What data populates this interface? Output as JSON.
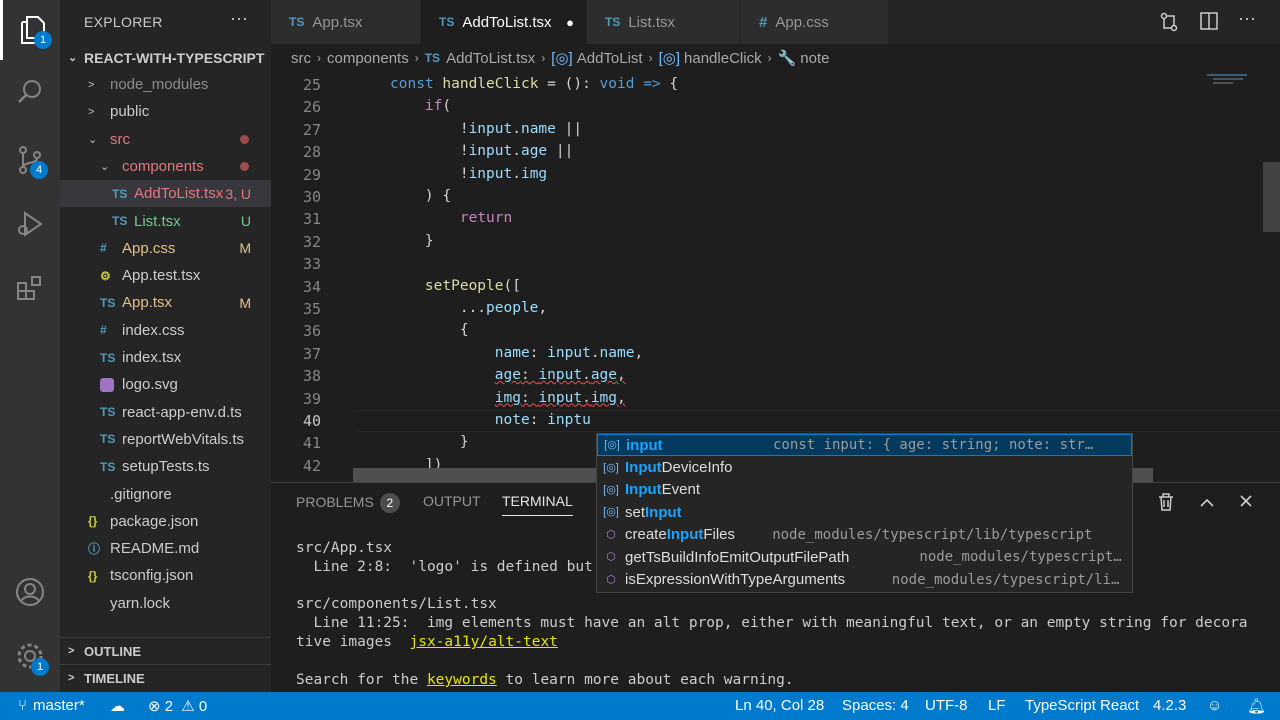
{
  "activity_bar": {
    "explorer_badge": "1",
    "scm_badge": "4",
    "settings_badge": "1"
  },
  "sidebar": {
    "title": "EXPLORER",
    "more": "···",
    "project": "REACT-WITH-TYPESCRIPT",
    "items": [
      {
        "label": "node_modules",
        "icon": ""
      },
      {
        "label": "public",
        "icon": ""
      },
      {
        "label": "src",
        "icon": ""
      },
      {
        "label": "components",
        "icon": ""
      },
      {
        "label": "AddToList.tsx",
        "icon": "TS",
        "status": "3, U"
      },
      {
        "label": "List.tsx",
        "icon": "TS",
        "status": "U"
      },
      {
        "label": "App.css",
        "icon": "#",
        "status": "M"
      },
      {
        "label": "App.test.tsx",
        "icon": "⚙"
      },
      {
        "label": "App.tsx",
        "icon": "TS",
        "status": "M"
      },
      {
        "label": "index.css",
        "icon": "#"
      },
      {
        "label": "index.tsx",
        "icon": "TS"
      },
      {
        "label": "logo.svg",
        "icon": ""
      },
      {
        "label": "react-app-env.d.ts",
        "icon": "TS"
      },
      {
        "label": "reportWebVitals.ts",
        "icon": "TS"
      },
      {
        "label": "setupTests.ts",
        "icon": "TS"
      },
      {
        "label": ".gitignore",
        "icon": ""
      },
      {
        "label": "package.json",
        "icon": "{}"
      },
      {
        "label": "README.md",
        "icon": "ⓘ"
      },
      {
        "label": "tsconfig.json",
        "icon": "{}"
      },
      {
        "label": "yarn.lock",
        "icon": ""
      }
    ],
    "outline": "OUTLINE",
    "timeline": "TIMELINE"
  },
  "tabs": [
    {
      "label": "App.tsx",
      "icon": "TS"
    },
    {
      "label": "AddToList.tsx",
      "icon": "TS",
      "modified": "●"
    },
    {
      "label": "List.tsx",
      "icon": "TS"
    },
    {
      "label": "App.css",
      "icon": "#"
    }
  ],
  "breadcrumb": [
    "src",
    "components",
    "AddToList.tsx",
    "AddToList",
    "handleClick",
    "note"
  ],
  "editor": {
    "line_numbers": [
      "25",
      "26",
      "27",
      "28",
      "29",
      "30",
      "31",
      "32",
      "33",
      "34",
      "35",
      "36",
      "37",
      "38",
      "39",
      "40",
      "41",
      "42"
    ],
    "lines": [
      "const handleClick = (): void => {",
      "    if(",
      "        !input.name ||",
      "        !input.age ||",
      "        !input.img",
      "    ) {",
      "        return",
      "    }",
      "",
      "    setPeople([",
      "        ...people,",
      "        {",
      "            name: input.name,",
      "            age: input.age,",
      "            img: input.img,",
      "            note: inptu",
      "        }",
      "    ])"
    ]
  },
  "suggest": [
    {
      "label": "input",
      "detail": "const input: { age: string; note: str…"
    },
    {
      "label": "InputDeviceInfo",
      "detail": ""
    },
    {
      "label": "InputEvent",
      "detail": ""
    },
    {
      "label": "setInput",
      "detail": ""
    },
    {
      "label": "createInputFiles",
      "detail": "node_modules/typescript/lib/typescript"
    },
    {
      "label": "getTsBuildInfoEmitOutputFilePath",
      "detail": "node_modules/typescript…"
    },
    {
      "label": "isExpressionWithTypeArguments",
      "detail": "node_modules/typescript/li…"
    }
  ],
  "panel": {
    "tabs": {
      "problems": "PROBLEMS",
      "problems_count": "2",
      "output": "OUTPUT",
      "terminal": "TERMINAL"
    },
    "terminal_lines": [
      "src/App.tsx",
      "  Line 2:8:  'logo' is defined but",
      "",
      "src/components/List.tsx",
      "  Line 11:25:  img elements must have an alt prop, either with meaningful text, or an empty string for decora",
      "tive images  ",
      "",
      "Search for the ",
      "to learn more about each warning."
    ],
    "rule_link": "jsx-a11y/alt-text",
    "keywords_link": "keywords"
  },
  "status": {
    "branch": "master*",
    "errors": "2",
    "warnings": "0",
    "position": "Ln 40, Col 28",
    "spaces": "Spaces: 4",
    "encoding": "UTF-8",
    "eol": "LF",
    "language": "TypeScript React",
    "version": "4.2.3"
  }
}
